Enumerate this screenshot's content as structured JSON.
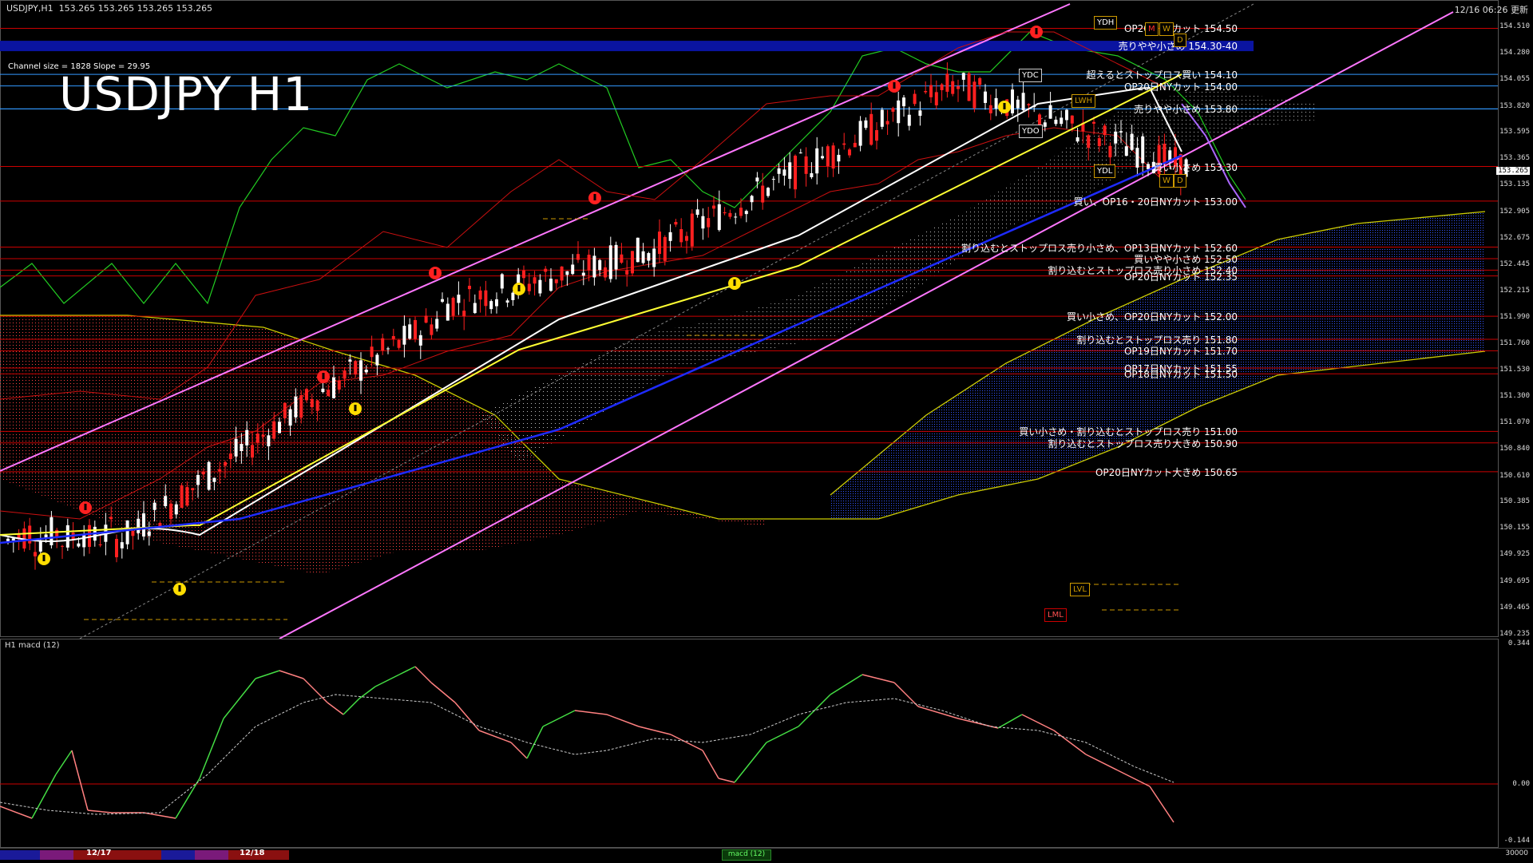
{
  "header": {
    "symbol_line": "USDJPY,H1  153.265 153.265 153.265 153.265",
    "timestamp": "12/16 06:26 更新"
  },
  "title": "USDJPY H1",
  "channel_info": "Channel size = 1828 Slope = 29.95",
  "price_scale": [
    "154.510",
    "154.280",
    "154.055",
    "153.820",
    "153.595",
    "153.365",
    "153.135",
    "152.905",
    "152.675",
    "152.445",
    "152.215",
    "151.990",
    "151.760",
    "151.530",
    "151.300",
    "151.070",
    "150.840",
    "150.610",
    "150.385",
    "150.155",
    "149.925",
    "149.695",
    "149.465",
    "149.235"
  ],
  "current_price": "153.265",
  "levels": [
    {
      "price": 154.5,
      "text": "OP20日NYカット 154.50",
      "color": "#cc0000"
    },
    {
      "price": 154.35,
      "text": "売りやや小さめ 154.30-40",
      "color": "#1a1aff",
      "band": true
    },
    {
      "price": 154.1,
      "text": "超えるとストップロス買い 154.10",
      "color": "#3399ff"
    },
    {
      "price": 154.0,
      "text": "OP20日NYカット 154.00",
      "color": "#3399ff"
    },
    {
      "price": 153.8,
      "text": "売りやや小さめ 153.80",
      "color": "#3399ff"
    },
    {
      "price": 153.3,
      "text": "買い小さめ 153.30",
      "color": "#cc0000"
    },
    {
      "price": 153.0,
      "text": "買い、OP16・20日NYカット 153.00",
      "color": "#cc0000"
    },
    {
      "price": 152.6,
      "text": "割り込むとストップロス売り小さめ、OP13日NYカット 152.60",
      "color": "#cc0000"
    },
    {
      "price": 152.5,
      "text": "買いやや小さめ 152.50",
      "color": "#cc0000"
    },
    {
      "price": 152.4,
      "text": "割り込むとストップロス売り小さめ 152.40",
      "color": "#cc0000"
    },
    {
      "price": 152.35,
      "text": "OP20日NYカット 152.35",
      "color": "#cc0000"
    },
    {
      "price": 152.0,
      "text": "買い小さめ、OP20日NYカット 152.00",
      "color": "#cc0000"
    },
    {
      "price": 151.8,
      "text": "割り込むとストップロス売り 151.80",
      "color": "#cc0000"
    },
    {
      "price": 151.7,
      "text": "OP19日NYカット 151.70",
      "color": "#cc0000"
    },
    {
      "price": 151.55,
      "text": "OP17日NYカット 151.55",
      "color": "#cc0000"
    },
    {
      "price": 151.5,
      "text": "OP18日NYカット 151.50",
      "color": "#cc0000"
    },
    {
      "price": 151.0,
      "text": "買い小さめ・割り込むとストップロス売り 151.00",
      "color": "#cc0000"
    },
    {
      "price": 150.9,
      "text": "割り込むとストップロス売り大きめ 150.90",
      "color": "#cc0000"
    },
    {
      "price": 150.65,
      "text": "OP20日NYカット大きめ 150.65",
      "color": "#cc0000"
    }
  ],
  "tags": {
    "ydh": "YDH",
    "ydc": "YDC",
    "ydo": "YDO",
    "ydl": "YDL",
    "lwh": "LWH",
    "lvl": "LVL",
    "lml": "LML",
    "hm": "M",
    "ww": "W",
    "d": "D",
    "wtag": "W",
    "dtag": "D"
  },
  "macd": {
    "title": "H1  macd (12)",
    "scale_top": "0.344",
    "scale_mid": "0.00",
    "scale_bot": "-0.144"
  },
  "bottom": {
    "date1": "12/17",
    "date2": "12/18",
    "macd_tab": "macd (12)",
    "right_value": "30000"
  },
  "colors": {
    "background": "#000000",
    "candle_up": "#ffffff",
    "candle_down": "#ff2020",
    "sma_fast": "#ffffff",
    "sma_mid": "#ffff33",
    "sma_slow": "#1e2bff",
    "channel": "#ff77ff",
    "macd_up": "#44dd44",
    "macd_down": "#ff8080"
  }
}
